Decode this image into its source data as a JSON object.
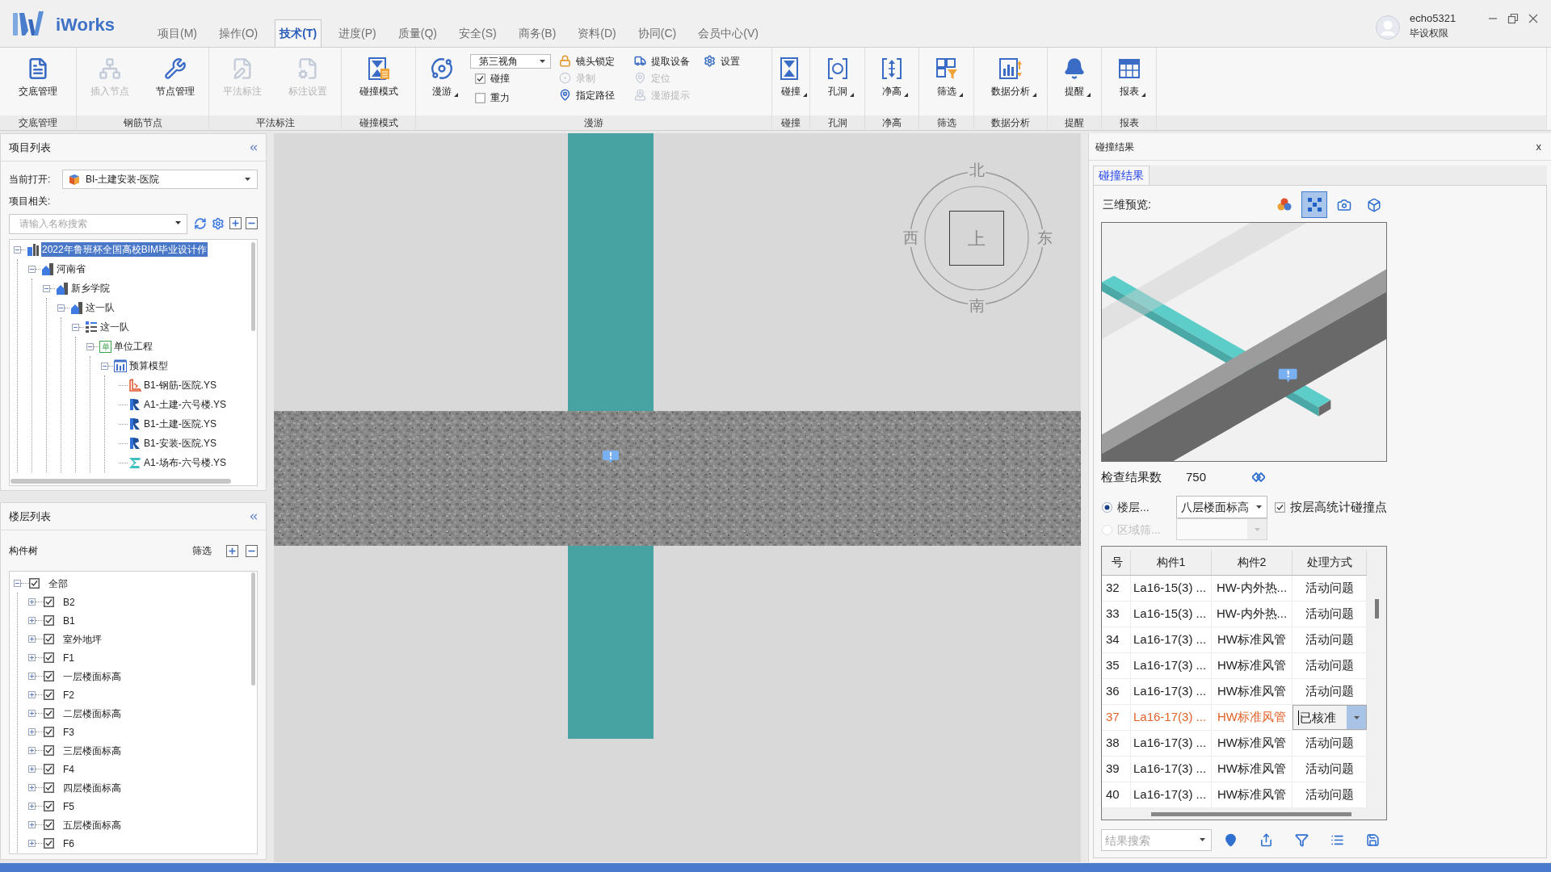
{
  "app": {
    "logo": "iWorks",
    "user_name": "echo5321",
    "user_role": "毕设权限"
  },
  "menu_tabs": [
    {
      "label": "项目(M)",
      "selected": false
    },
    {
      "label": "操作(O)",
      "selected": false
    },
    {
      "label": "技术(T)",
      "selected": true
    },
    {
      "label": "进度(P)",
      "selected": false
    },
    {
      "label": "质量(Q)",
      "selected": false
    },
    {
      "label": "安全(S)",
      "selected": false
    },
    {
      "label": "商务(B)",
      "selected": false
    },
    {
      "label": "资料(D)",
      "selected": false
    },
    {
      "label": "协同(C)",
      "selected": false
    },
    {
      "label": "会员中心(V)",
      "selected": false
    }
  ],
  "ribbon": {
    "groups": [
      {
        "label": "交底管理",
        "columns": [
          [
            {
              "kind": "large",
              "label": "交底管理",
              "disabled": false,
              "dropdown": false
            }
          ]
        ]
      },
      {
        "label": "钢筋节点",
        "columns": [
          [
            {
              "kind": "large",
              "label": "插入节点",
              "disabled": true,
              "dropdown": false
            }
          ],
          [
            {
              "kind": "large",
              "label": "节点管理",
              "disabled": false,
              "dropdown": false
            }
          ]
        ]
      },
      {
        "label": "平法标注",
        "columns": [
          [
            {
              "kind": "large",
              "label": "平法标注",
              "disabled": true,
              "dropdown": false
            }
          ],
          [
            {
              "kind": "large",
              "label": "标注设置",
              "disabled": true,
              "dropdown": false
            }
          ]
        ]
      },
      {
        "label": "碰撞模式",
        "columns": [
          [
            {
              "kind": "large",
              "label": "碰撞模式",
              "disabled": false,
              "dropdown": false
            }
          ]
        ]
      },
      {
        "label": "漫游",
        "columns": [
          [
            {
              "kind": "large",
              "label": "漫游",
              "disabled": false,
              "dropdown": true
            }
          ],
          [
            {
              "kind": "select",
              "value": "第三视角",
              "disabled": false
            },
            {
              "kind": "checkbox",
              "label": "碰撞",
              "checked": true,
              "disabled": false
            },
            {
              "kind": "checkbox",
              "label": "重力",
              "checked": false,
              "disabled": false
            }
          ],
          [
            {
              "kind": "small",
              "label": "镜头锁定",
              "disabled": false
            },
            {
              "kind": "small",
              "label": "录制",
              "disabled": true
            },
            {
              "kind": "small",
              "label": "指定路径",
              "disabled": false
            }
          ],
          [
            {
              "kind": "small",
              "label": "提取设备",
              "disabled": false
            },
            {
              "kind": "small",
              "label": "定位",
              "disabled": true
            },
            {
              "kind": "small",
              "label": "漫游提示",
              "disabled": true
            }
          ],
          [
            {
              "kind": "small",
              "label": "设置",
              "disabled": false
            }
          ]
        ]
      },
      {
        "label": "碰撞",
        "columns": [
          [
            {
              "kind": "large",
              "label": "碰撞",
              "disabled": false,
              "dropdown": true
            }
          ]
        ]
      },
      {
        "label": "孔洞",
        "columns": [
          [
            {
              "kind": "large",
              "label": "孔洞",
              "disabled": false,
              "dropdown": true
            }
          ]
        ]
      },
      {
        "label": "净高",
        "columns": [
          [
            {
              "kind": "large",
              "label": "净高",
              "disabled": false,
              "dropdown": true
            }
          ]
        ]
      },
      {
        "label": "筛选",
        "columns": [
          [
            {
              "kind": "large",
              "label": "筛选",
              "disabled": false,
              "dropdown": true
            }
          ]
        ]
      },
      {
        "label": "数据分析",
        "columns": [
          [
            {
              "kind": "large",
              "label": "数据分析",
              "disabled": false,
              "dropdown": true
            }
          ]
        ]
      },
      {
        "label": "提醒",
        "columns": [
          [
            {
              "kind": "large",
              "label": "提醒",
              "disabled": false,
              "dropdown": true
            }
          ]
        ]
      },
      {
        "label": "报表",
        "columns": [
          [
            {
              "kind": "large",
              "label": "报表",
              "disabled": false,
              "dropdown": true
            }
          ]
        ]
      }
    ]
  },
  "project_panel": {
    "title": "项目列表",
    "current_label": "当前打开:",
    "current_value": "BI-土建安装-医院",
    "related_label": "项目相关:",
    "search_placeholder": "请输入名称搜索",
    "tree": [
      {
        "label": "2022年鲁班杯全国高校BIM毕业设计作",
        "kind": "project",
        "selected": true,
        "expanded": true,
        "children": [
          {
            "label": "河南省",
            "kind": "region",
            "selected": false,
            "expanded": true,
            "children": [
              {
                "label": "新乡学院",
                "kind": "region",
                "selected": false,
                "expanded": true,
                "children": [
                  {
                    "label": "这一队",
                    "kind": "region",
                    "selected": false,
                    "expanded": true,
                    "children": [
                      {
                        "label": "这一队",
                        "kind": "group",
                        "selected": false,
                        "expanded": true,
                        "children": [
                          {
                            "label": "单位工程",
                            "kind": "unit",
                            "badge": "单",
                            "selected": false,
                            "expanded": true,
                            "children": [
                              {
                                "label": "预算模型",
                                "kind": "model",
                                "selected": false,
                                "expanded": true,
                                "children": [
                                  {
                                    "label": "B1-钢筋-医院.YS",
                                    "kind": "rebar-file",
                                    "selected": false
                                  },
                                  {
                                    "label": "A1-土建-六号楼.YS",
                                    "kind": "model-file",
                                    "selected": false
                                  },
                                  {
                                    "label": "B1-土建-医院.YS",
                                    "kind": "model-file",
                                    "selected": false
                                  },
                                  {
                                    "label": "B1-安装-医院.YS",
                                    "kind": "model-file",
                                    "selected": false
                                  },
                                  {
                                    "label": "A1-场布-六号楼.YS",
                                    "kind": "site-file",
                                    "selected": false
                                  }
                                ]
                              }
                            ]
                          }
                        ]
                      }
                    ]
                  }
                ]
              }
            ]
          }
        ]
      }
    ]
  },
  "floor_panel": {
    "title": "楼层列表",
    "tree_label": "构件树",
    "filter_button": "筛选",
    "tree": [
      {
        "label": "全部",
        "checked": true,
        "expanded": true,
        "children": [
          {
            "label": "B2",
            "checked": true,
            "expanded": false
          },
          {
            "label": "B1",
            "checked": true,
            "expanded": false
          },
          {
            "label": "室外地坪",
            "checked": true,
            "expanded": false
          },
          {
            "label": "F1",
            "checked": true,
            "expanded": false
          },
          {
            "label": "一层楼面标高",
            "checked": true,
            "expanded": false
          },
          {
            "label": "F2",
            "checked": true,
            "expanded": false
          },
          {
            "label": "二层楼面标高",
            "checked": true,
            "expanded": false
          },
          {
            "label": "F3",
            "checked": true,
            "expanded": false
          },
          {
            "label": "三层楼面标高",
            "checked": true,
            "expanded": false
          },
          {
            "label": "F4",
            "checked": true,
            "expanded": false
          },
          {
            "label": "四层楼面标高",
            "checked": true,
            "expanded": false
          },
          {
            "label": "F5",
            "checked": true,
            "expanded": false
          },
          {
            "label": "五层楼面标高",
            "checked": true,
            "expanded": false
          },
          {
            "label": "F6",
            "checked": true,
            "expanded": false
          }
        ]
      }
    ]
  },
  "view_cube": {
    "north": "北",
    "east": "东",
    "south": "南",
    "west": "西",
    "face": "上"
  },
  "results_panel": {
    "title": "碰撞结果",
    "close": "x",
    "tabs": [
      {
        "label": "碰撞结果",
        "selected": true
      }
    ],
    "preview_label": "三维预览:",
    "preview_tools": [
      {
        "selected": false
      },
      {
        "selected": true
      },
      {
        "selected": false
      },
      {
        "selected": false
      }
    ],
    "count_label": "检查结果数",
    "count_value": "750",
    "filter_options": [
      {
        "label": "楼层...",
        "selected": true,
        "disabled": false
      },
      {
        "label": "区域筛...",
        "selected": false,
        "disabled": true
      }
    ],
    "floor_select": {
      "value": "八层楼面标高"
    },
    "region_select": {
      "disabled": true
    },
    "stat_checkbox": {
      "label": "按层高统计碰撞点",
      "checked": true
    },
    "table": {
      "columns": [
        "号",
        "构件1",
        "构件2",
        "处理方式"
      ],
      "rows": [
        {
          "cells": [
            "32",
            "La16-15(3) ...",
            "HW-内外热...",
            "活动问题"
          ],
          "selected": false
        },
        {
          "cells": [
            "33",
            "La16-15(3) ...",
            "HW-内外热...",
            "活动问题"
          ],
          "selected": false
        },
        {
          "cells": [
            "34",
            "La16-17(3) ...",
            "HW标准风管",
            "活动问题"
          ],
          "selected": false
        },
        {
          "cells": [
            "35",
            "La16-17(3) ...",
            "HW标准风管",
            "活动问题"
          ],
          "selected": false
        },
        {
          "cells": [
            "36",
            "La16-17(3) ...",
            "HW标准风管",
            "活动问题"
          ],
          "selected": false
        },
        {
          "cells": [
            "37",
            "La16-17(3) ...",
            "HW标准风管",
            "已核准"
          ],
          "selected": true
        },
        {
          "cells": [
            "38",
            "La16-17(3) ...",
            "HW标准风管",
            "活动问题"
          ],
          "selected": false
        },
        {
          "cells": [
            "39",
            "La16-17(3) ...",
            "HW标准风管",
            "活动问题"
          ],
          "selected": false
        },
        {
          "cells": [
            "40",
            "La16-17(3) ...",
            "HW标准风管",
            "活动问题"
          ],
          "selected": false
        }
      ]
    },
    "search": {
      "placeholder": "结果搜索"
    }
  }
}
